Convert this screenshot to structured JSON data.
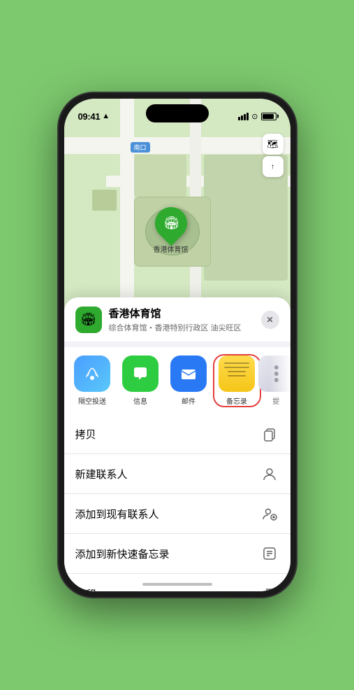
{
  "status": {
    "time": "09:41",
    "location_arrow": "▲"
  },
  "map": {
    "south_label": "南口",
    "controls": {
      "map_icon": "🗺",
      "compass_icon": "⊕"
    },
    "pin_label": "香港体育馆",
    "pin_emoji": "🏟"
  },
  "venue_card": {
    "name": "香港体育馆",
    "desc": "综合体育馆・香港特别行政区 油尖旺区",
    "close_label": "✕",
    "icon_emoji": "🏟"
  },
  "share_items": [
    {
      "label": "隔空投送",
      "type": "airdrop"
    },
    {
      "label": "信息",
      "type": "message"
    },
    {
      "label": "邮件",
      "type": "mail"
    },
    {
      "label": "备忘录",
      "type": "notes",
      "selected": true
    },
    {
      "label": "提",
      "type": "more"
    }
  ],
  "actions": [
    {
      "label": "拷贝",
      "icon": "copy"
    },
    {
      "label": "新建联系人",
      "icon": "person"
    },
    {
      "label": "添加到现有联系人",
      "icon": "person-add"
    },
    {
      "label": "添加到新快速备忘录",
      "icon": "note"
    },
    {
      "label": "打印",
      "icon": "printer"
    }
  ]
}
